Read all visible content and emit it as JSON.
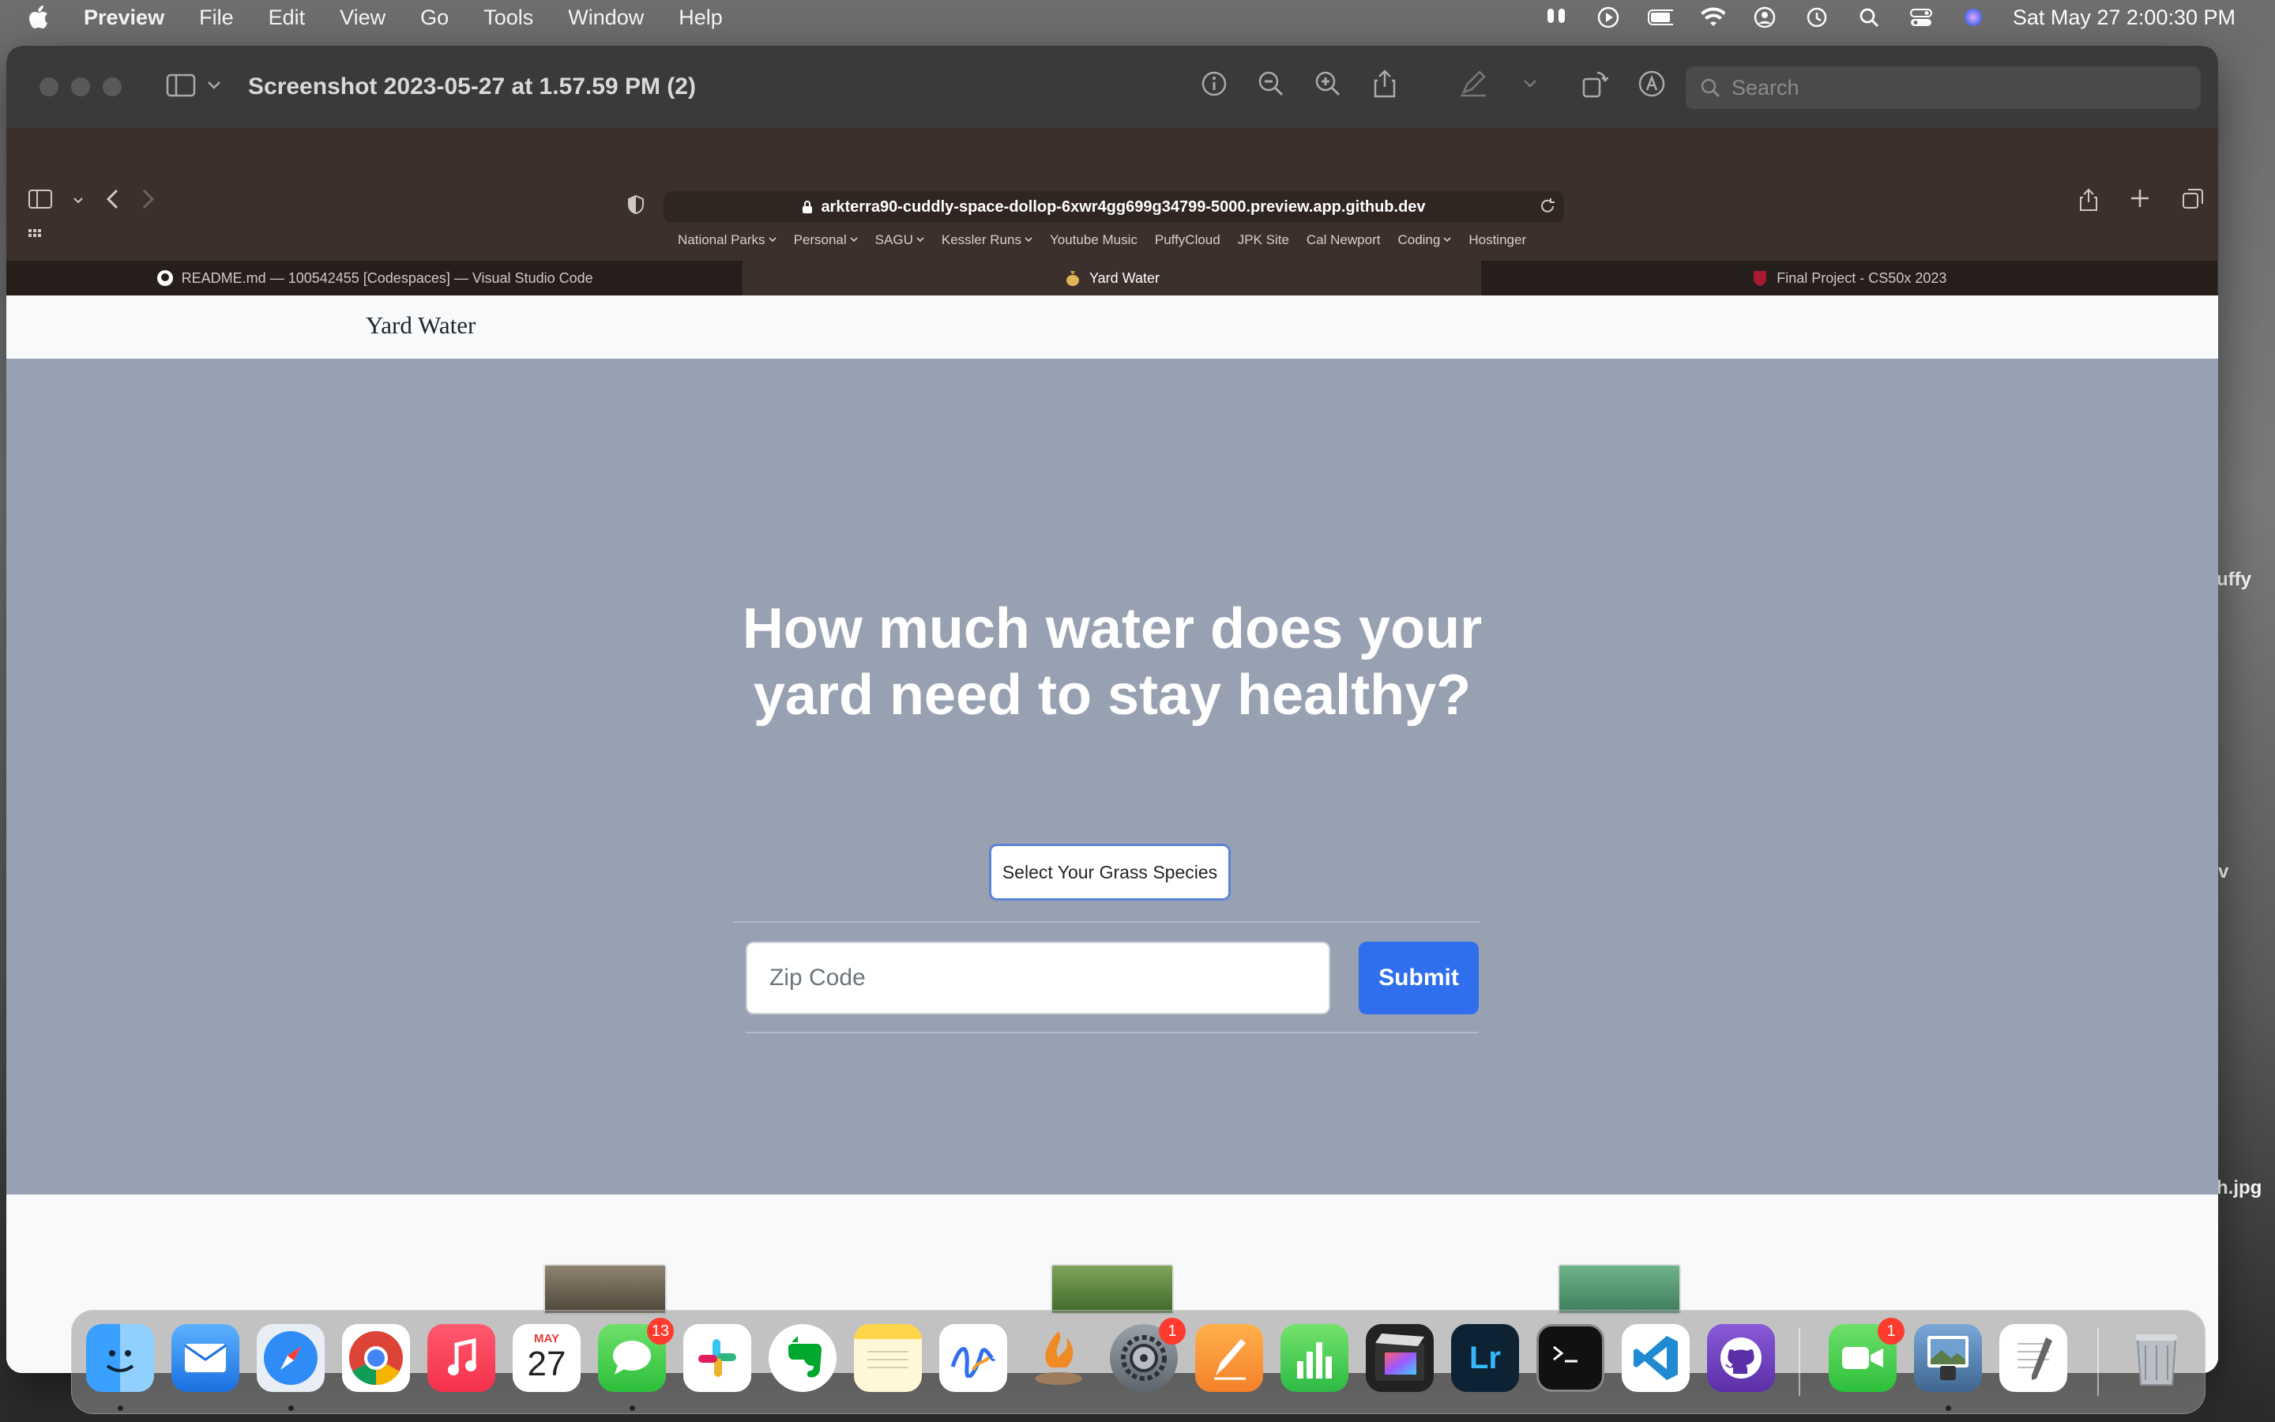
{
  "menubar": {
    "app_name": "Preview",
    "items": [
      "File",
      "Edit",
      "View",
      "Go",
      "Tools",
      "Window",
      "Help"
    ],
    "clock": "Sat May 27  2:00:30 PM"
  },
  "desktop": {
    "labels": [
      "uffy",
      "v",
      "h.jpg"
    ]
  },
  "preview": {
    "document_title": "Screenshot 2023-05-27 at 1.57.59 PM (2)",
    "search_placeholder": "Search"
  },
  "safari": {
    "url": "arkterra90-cuddly-space-dollop-6xwr4gg699g34799-5000.preview.app.github.dev",
    "bookmarks": [
      {
        "label": "National Parks",
        "menu": true
      },
      {
        "label": "Personal",
        "menu": true
      },
      {
        "label": "SAGU",
        "menu": true
      },
      {
        "label": "Kessler Runs",
        "menu": true
      },
      {
        "label": "Youtube Music",
        "menu": false
      },
      {
        "label": "PuffyCloud",
        "menu": false
      },
      {
        "label": "JPK Site",
        "menu": false
      },
      {
        "label": "Cal Newport",
        "menu": false
      },
      {
        "label": "Coding",
        "menu": true
      },
      {
        "label": "Hostinger",
        "menu": false
      }
    ],
    "tabs": [
      {
        "label": "README.md — 100542455 [Codespaces] — Visual Studio Code",
        "active": false
      },
      {
        "label": "Yard Water",
        "active": true
      },
      {
        "label": "Final Project - CS50x 2023",
        "active": false
      }
    ]
  },
  "page": {
    "brand": "Yard Water",
    "hero_line1": "How much water does your",
    "hero_line2": "yard need to stay healthy?",
    "species_button": "Select Your Grass Species",
    "zip_placeholder": "Zip Code",
    "submit_label": "Submit"
  },
  "dock": {
    "calendar_month": "MAY",
    "calendar_day": "27",
    "messages_badge": "13",
    "settings_badge": "1",
    "facetime_badge": "1",
    "lightroom_label": "Lr"
  },
  "colors": {
    "hero_bg": "#98a1b2",
    "submit_bg": "#2f6fed",
    "safari_toolbar": "#3b302b"
  }
}
